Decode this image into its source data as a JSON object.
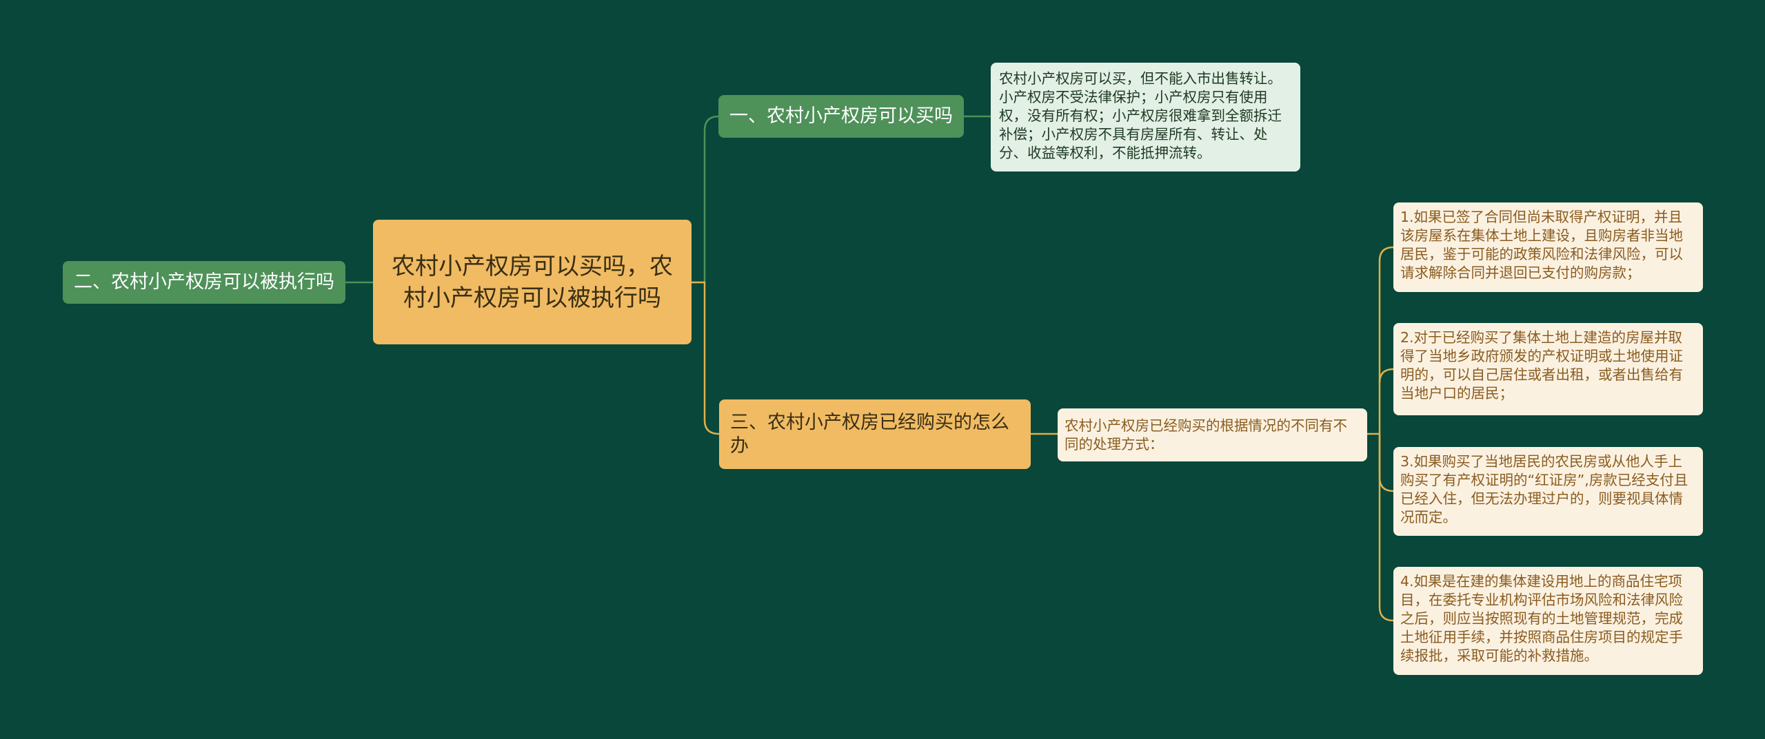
{
  "colors": {
    "background": "#08473a",
    "root_fill": "#f0bb63",
    "green_node": "#4e9159",
    "light_leaf": "#e3f0e5",
    "cream_leaf": "#fbf1e1",
    "green_line": "#4e9159",
    "orange_line": "#e0b04a"
  },
  "root": {
    "label": "农村小产权房可以买吗，农村小产权房可以被执行吗"
  },
  "branch_left": {
    "label": "二、农村小产权房可以被执行吗"
  },
  "branch_one": {
    "label": "一、农村小产权房可以买吗",
    "detail": "农村小产权房可以买，但不能入市出售转让。小产权房不受法律保护；小产权房只有使用权，没有所有权；小产权房很难拿到全额拆迁补偿；小产权房不具有房屋所有、转让、处分、收益等权利，不能抵押流转。"
  },
  "branch_three": {
    "label": "三、农村小产权房已经购买的怎么办",
    "summary": "农村小产权房已经购买的根据情况的不同有不同的处理方式：",
    "items": [
      "1.如果已签了合同但尚未取得产权证明，并且该房屋系在集体土地上建设，且购房者非当地居民，鉴于可能的政策风险和法律风险，可以请求解除合同并退回已支付的购房款；",
      "2.对于已经购买了集体土地上建造的房屋并取得了当地乡政府颁发的产权证明或土地使用证明的，可以自己居住或者出租，或者出售给有当地户口的居民；",
      "3.如果购买了当地居民的农民房或从他人手上购买了有产权证明的“红证房”,房款已经支付且已经入住，但无法办理过户的，则要视具体情况而定。",
      "4.如果是在建的集体建设用地上的商品住宅项目，在委托专业机构评估市场风险和法律风险之后，则应当按照现有的土地管理规范，完成土地征用手续，并按照商品住房项目的规定手续报批，采取可能的补救措施。"
    ]
  }
}
